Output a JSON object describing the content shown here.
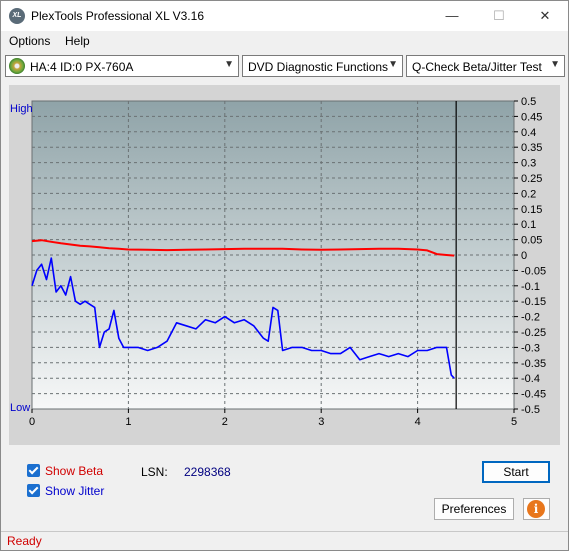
{
  "window": {
    "title": "PlexTools Professional XL V3.16",
    "app_icon": "XL",
    "minimize_icon": "—",
    "maximize_icon": "☐",
    "close_icon": "✕"
  },
  "menu": {
    "options": "Options",
    "help": "Help"
  },
  "toolbar": {
    "drive": "HA:4 ID:0  PX-760A",
    "function": "DVD Diagnostic Functions",
    "test": "Q-Check Beta/Jitter Test"
  },
  "chart_data": {
    "type": "line",
    "xlim": [
      0,
      5
    ],
    "ylim": [
      -0.5,
      0.5
    ],
    "x_ticks": [
      "0",
      "1",
      "2",
      "3",
      "4",
      "5"
    ],
    "y_ticks": [
      "0.5",
      "0.45",
      "0.4",
      "0.35",
      "0.3",
      "0.25",
      "0.2",
      "0.15",
      "0.1",
      "0.05",
      "0",
      "-0.05",
      "-0.1",
      "-0.15",
      "-0.2",
      "-0.25",
      "-0.3",
      "-0.35",
      "-0.4",
      "-0.45",
      "-0.5"
    ],
    "y_high_label": "High",
    "y_low_label": "Low",
    "end_marker_x": 4.4,
    "grid": true,
    "series": [
      {
        "color": "#ff0000",
        "x": [
          0,
          0.1,
          0.2,
          0.3,
          0.4,
          0.5,
          0.6,
          0.7,
          0.8,
          0.9,
          1.0,
          1.2,
          1.4,
          1.6,
          1.8,
          2.0,
          2.2,
          2.4,
          2.6,
          2.8,
          3.0,
          3.2,
          3.4,
          3.6,
          3.8,
          4.0,
          4.1,
          4.2,
          4.3,
          4.38
        ],
        "y": [
          0.045,
          0.048,
          0.043,
          0.038,
          0.034,
          0.03,
          0.028,
          0.025,
          0.022,
          0.02,
          0.018,
          0.017,
          0.016,
          0.017,
          0.018,
          0.019,
          0.02,
          0.02,
          0.02,
          0.018,
          0.017,
          0.018,
          0.019,
          0.02,
          0.02,
          0.018,
          0.015,
          0.003,
          0.0,
          -0.002
        ]
      },
      {
        "color": "#0000ff",
        "x": [
          0,
          0.05,
          0.1,
          0.15,
          0.2,
          0.25,
          0.3,
          0.35,
          0.4,
          0.45,
          0.5,
          0.55,
          0.6,
          0.65,
          0.7,
          0.75,
          0.8,
          0.85,
          0.9,
          0.95,
          1.0,
          1.1,
          1.2,
          1.3,
          1.4,
          1.5,
          1.6,
          1.7,
          1.8,
          1.9,
          2.0,
          2.1,
          2.2,
          2.3,
          2.4,
          2.45,
          2.5,
          2.55,
          2.6,
          2.7,
          2.8,
          2.9,
          3.0,
          3.1,
          3.2,
          3.3,
          3.4,
          3.5,
          3.6,
          3.7,
          3.8,
          3.9,
          4.0,
          4.1,
          4.2,
          4.3,
          4.35,
          4.38
        ],
        "y": [
          -0.1,
          -0.05,
          -0.03,
          -0.08,
          -0.01,
          -0.12,
          -0.1,
          -0.13,
          -0.07,
          -0.15,
          -0.16,
          -0.15,
          -0.16,
          -0.17,
          -0.3,
          -0.25,
          -0.24,
          -0.18,
          -0.27,
          -0.3,
          -0.3,
          -0.3,
          -0.31,
          -0.3,
          -0.28,
          -0.22,
          -0.23,
          -0.24,
          -0.21,
          -0.22,
          -0.2,
          -0.22,
          -0.21,
          -0.23,
          -0.27,
          -0.28,
          -0.17,
          -0.18,
          -0.31,
          -0.3,
          -0.3,
          -0.31,
          -0.31,
          -0.32,
          -0.32,
          -0.3,
          -0.34,
          -0.33,
          -0.32,
          -0.33,
          -0.32,
          -0.33,
          -0.31,
          -0.31,
          -0.3,
          -0.3,
          -0.39,
          -0.4
        ]
      }
    ]
  },
  "bottom": {
    "show_beta": "Show Beta",
    "show_jitter": "Show Jitter",
    "lsn_label": "LSN:",
    "lsn_value": "2298368",
    "start_label": "Start",
    "preferences_label": "Preferences",
    "info_icon": "i"
  },
  "status": {
    "text": "Ready"
  }
}
